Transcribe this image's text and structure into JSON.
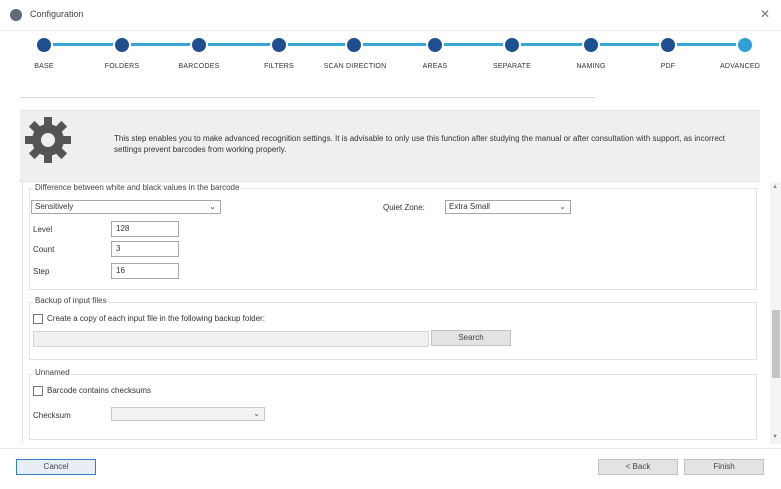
{
  "window": {
    "title": "Configuration",
    "icon": "app-icon",
    "close_icon": "close-icon",
    "close_glyph": "✕"
  },
  "steps": [
    {
      "label": "BASE",
      "active": false
    },
    {
      "label": "FOLDERS",
      "active": false
    },
    {
      "label": "BARCODES",
      "active": false
    },
    {
      "label": "FILTERS",
      "active": false
    },
    {
      "label": "SCAN DIRECTION",
      "active": false
    },
    {
      "label": "AREAS",
      "active": false
    },
    {
      "label": "SEPARATE",
      "active": false
    },
    {
      "label": "NAMING",
      "active": false
    },
    {
      "label": "PDF",
      "active": false
    },
    {
      "label": "ADVANCED",
      "active": true
    }
  ],
  "info": {
    "icon": "gear-icon",
    "text": "This step enables you to make advanced recognition settings. It is advisable to only use this function after studying the manual or after consultation with support, as incorrect settings prevent barcodes from working properly."
  },
  "difference": {
    "label": "Difference between white and black values in the barcode",
    "mode_value": "Sensitively",
    "quiet_zone_label": "Quiet Zone:",
    "quiet_zone_value": "Extra Small",
    "level_label": "Level",
    "level_value": "128",
    "count_label": "Count",
    "count_value": "3",
    "step_label": "Step",
    "step_value": "16"
  },
  "backup": {
    "label": "Backup of input files",
    "checkbox_label": "Create a copy of each input file in the following backup folder:",
    "checked": false,
    "folder_value": "",
    "search_label": "Search"
  },
  "unnamed": {
    "label": "Unnamed",
    "checkbox_label": "Barcode contains checksums",
    "checked": false,
    "checksum_label": "Checksum",
    "checksum_value": ""
  },
  "footer": {
    "cancel_label": "Cancel",
    "back_label": "< Back",
    "finish_label": "Finish"
  },
  "colors": {
    "accent": "#3aa6d8",
    "step_dot": "#1f4f8f",
    "step_active": "#2f9fd6"
  }
}
